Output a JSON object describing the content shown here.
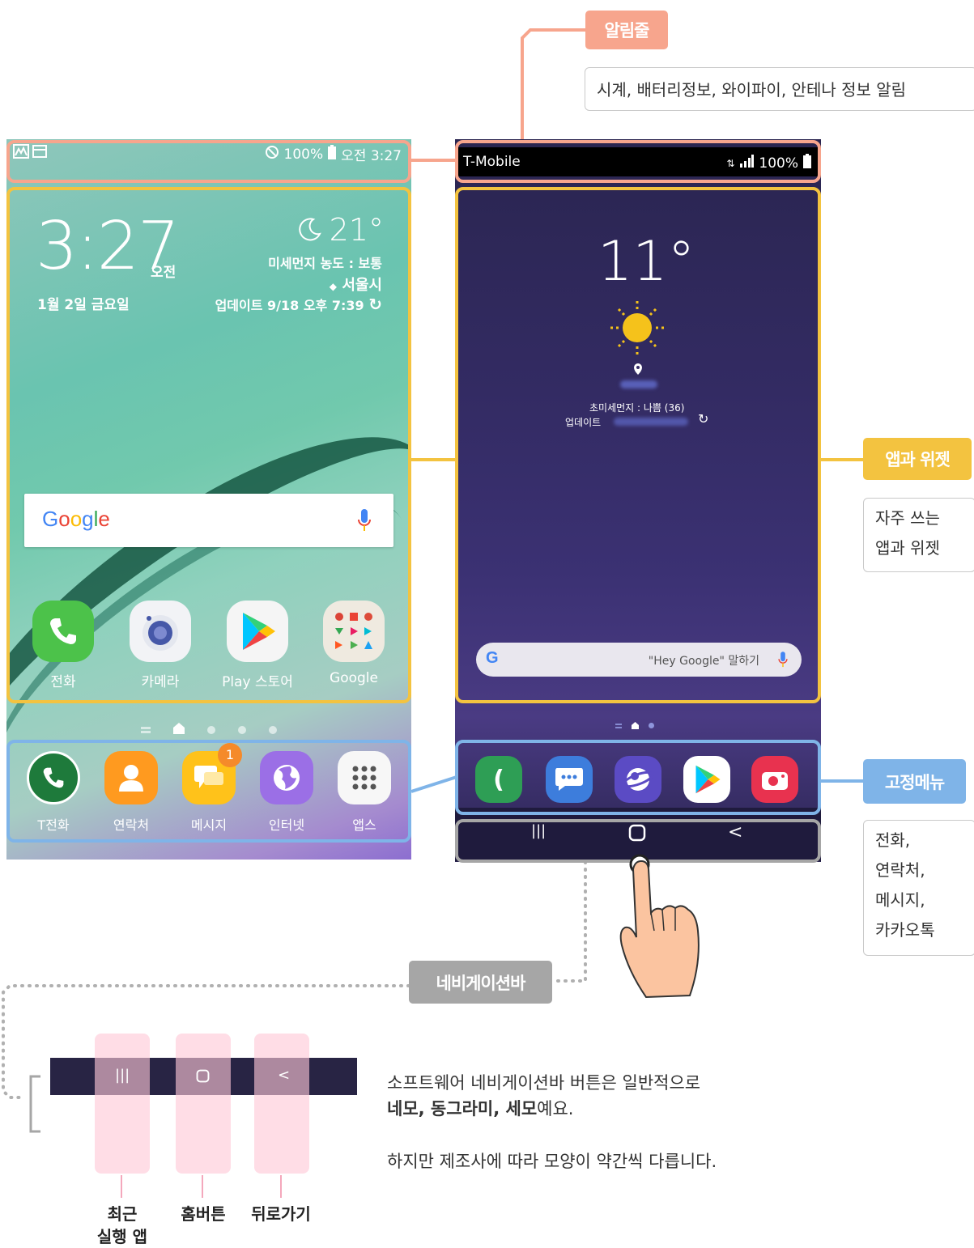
{
  "callouts": {
    "notification": {
      "label": "알림줄",
      "desc": "시계, 배터리정보, 와이파이, 안테나 정보 알림",
      "color": "#f7a58d"
    },
    "apps": {
      "label": "앱과 위젯",
      "desc_lines": [
        "자주 쓰는",
        "앱과 위젯"
      ],
      "color": "#f3c340"
    },
    "dock": {
      "label": "고정메뉴",
      "desc_lines": [
        "전화,",
        "연락처,",
        "메시지,",
        "카카오톡"
      ],
      "color": "#7fb4e8"
    },
    "navbar": {
      "label": "네비게이션바",
      "color": "#a6a6a6"
    }
  },
  "phone_left": {
    "status_right": "100%",
    "status_time": "오전 3:27",
    "clock": "3:27",
    "ampm": "오전",
    "date": "1월 2일 금요일",
    "temp": "21°",
    "dust": "미세먼지 농도 : 보통",
    "city": "서울시",
    "update": "업데이트 9/18 오후 7:39",
    "google_logo": "Google",
    "apps": [
      {
        "label": "전화",
        "icon": "phone-icon"
      },
      {
        "label": "카메라",
        "icon": "camera-icon"
      },
      {
        "label": "Play 스토어",
        "icon": "play-store-icon"
      },
      {
        "label": "Google",
        "icon": "google-folder-icon"
      }
    ],
    "dock": [
      {
        "label": "T전화",
        "icon": "t-phone-icon"
      },
      {
        "label": "연락처",
        "icon": "contacts-icon"
      },
      {
        "label": "메시지",
        "icon": "message-icon",
        "badge": "1"
      },
      {
        "label": "인터넷",
        "icon": "internet-icon"
      },
      {
        "label": "앱스",
        "icon": "apps-grid-icon"
      }
    ]
  },
  "phone_right": {
    "carrier": "T-Mobile",
    "battery": "100%",
    "temp": "11°",
    "dust": "초미세먼지 : 나쁨 (36)",
    "update": "업데이트",
    "search_hint": "\"Hey Google\" 말하기",
    "nav_recent": "|||",
    "nav_back": "<"
  },
  "navbar_sample": {
    "recent_glyph": "|||",
    "back_glyph": "<",
    "labels": {
      "recent_line1": "최근",
      "recent_line2": "실행 앱",
      "home": "홈버튼",
      "back": "뒤로가기"
    }
  },
  "description": {
    "line1": "소프트웨어 네비게이션바 버튼은 일반적으로",
    "line2_bold": "네모, 동그라미, 세모",
    "line2_rest": "예요.",
    "line3": "하지만 제조사에 따라 모양이 약간씩 다릅니다."
  }
}
